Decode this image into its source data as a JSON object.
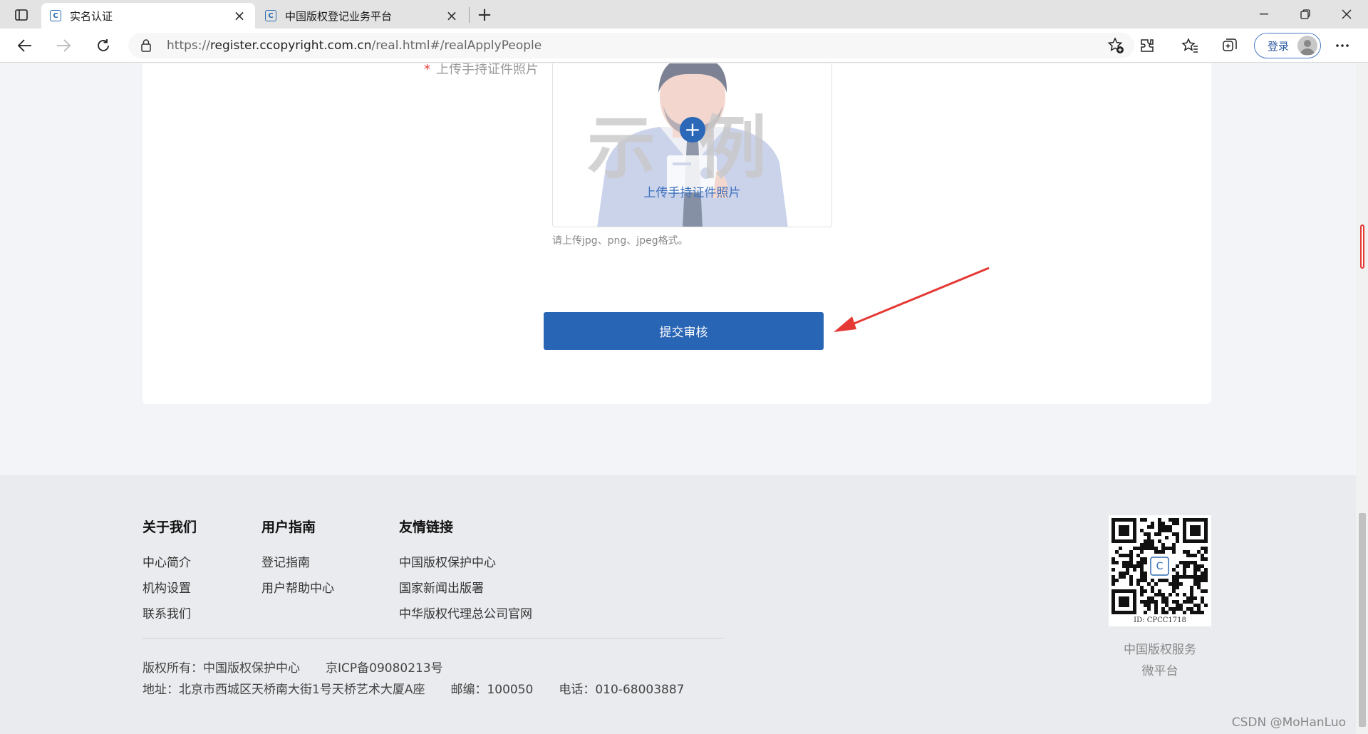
{
  "browser": {
    "tabs": [
      {
        "title": "实名认证",
        "active": true
      },
      {
        "title": "中国版权登记业务平台",
        "active": false
      }
    ],
    "url_prefix": "https://",
    "url_host": "register.ccopyright.com.cn",
    "url_path": "/real.html#/realApplyPeople",
    "login_label": "登录"
  },
  "form": {
    "field_label": "上传手持证件照片",
    "required_mark": "*",
    "sample_left": "示",
    "sample_right": "例",
    "upload_caption": "上传手持证件照片",
    "upload_hint": "请上传jpg、png、jpeg格式。",
    "submit_label": "提交审核"
  },
  "footer": {
    "columns": [
      {
        "title": "关于我们",
        "links": [
          "中心简介",
          "机构设置",
          "联系我们"
        ]
      },
      {
        "title": "用户指南",
        "links": [
          "登记指南",
          "用户帮助中心"
        ]
      },
      {
        "title": "友情链接",
        "links": [
          "中国版权保护中心",
          "国家新闻出版署",
          "中华版权代理总公司官网"
        ]
      }
    ],
    "copyright": "版权所有：中国版权保护中心",
    "icp": "京ICP备09080213号",
    "address": "地址：北京市西城区天桥南大街1号天桥艺术大厦A座",
    "postcode": "邮编：100050",
    "phone": "电话：010-68003887",
    "qr_id": "ID: CPCC1718",
    "qr_caption_line1": "中国版权服务",
    "qr_caption_line2": "微平台"
  },
  "watermark": "CSDN @MoHanLuo",
  "colors": {
    "accent": "#2965b5",
    "required": "#e53935",
    "annotation_arrow": "#e53935"
  }
}
